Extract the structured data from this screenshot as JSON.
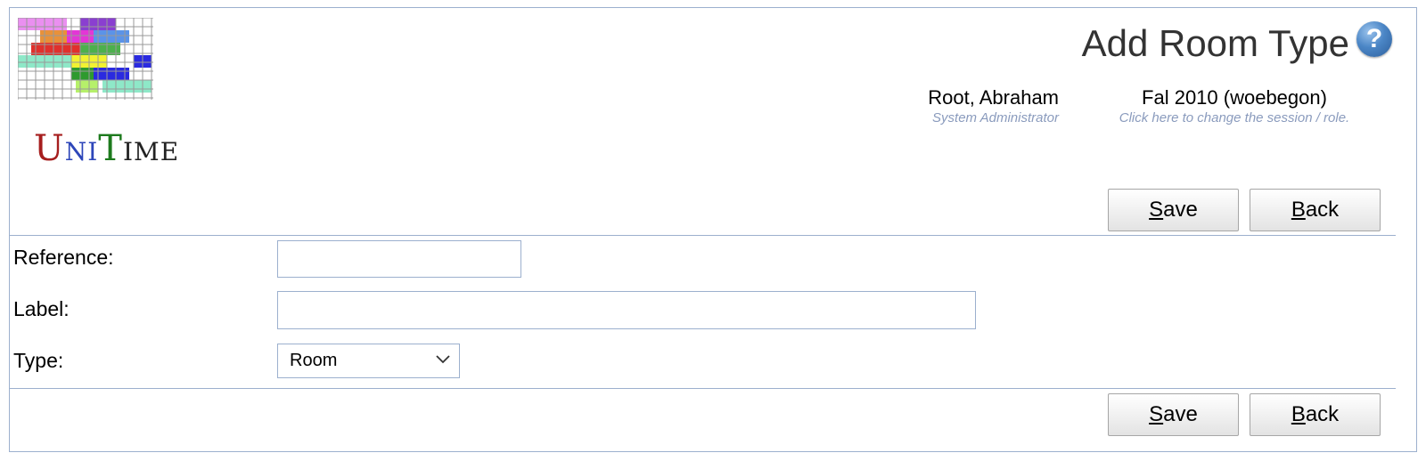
{
  "app": {
    "logo_text_u": "U",
    "logo_text_ni": "NI",
    "logo_text_t": "T",
    "logo_text_ime": "IME",
    "colors": {
      "logo_u": "#a61e1e",
      "logo_ni": "#2d46b9",
      "logo_t": "#1d7a1d",
      "logo_ime": "#222222"
    }
  },
  "header": {
    "title": "Add Room Type",
    "help_icon": "question-mark-icon",
    "help_glyph": "?",
    "user": {
      "name": "Root, Abraham",
      "role": "System Administrator"
    },
    "session": {
      "name": "Fal 2010 (woebegon)",
      "hint": "Click here to change the session / role."
    }
  },
  "toolbar": {
    "save_label_u": "S",
    "save_label_rest": "ave",
    "back_label_u": "B",
    "back_label_rest": "ack"
  },
  "form": {
    "reference": {
      "label": "Reference:",
      "value": ""
    },
    "label": {
      "label": "Label:",
      "value": ""
    },
    "type": {
      "label": "Type:",
      "selected": "Room"
    }
  },
  "colors": {
    "border": "#9cb0ce",
    "subtext": "#8a9bbd"
  }
}
